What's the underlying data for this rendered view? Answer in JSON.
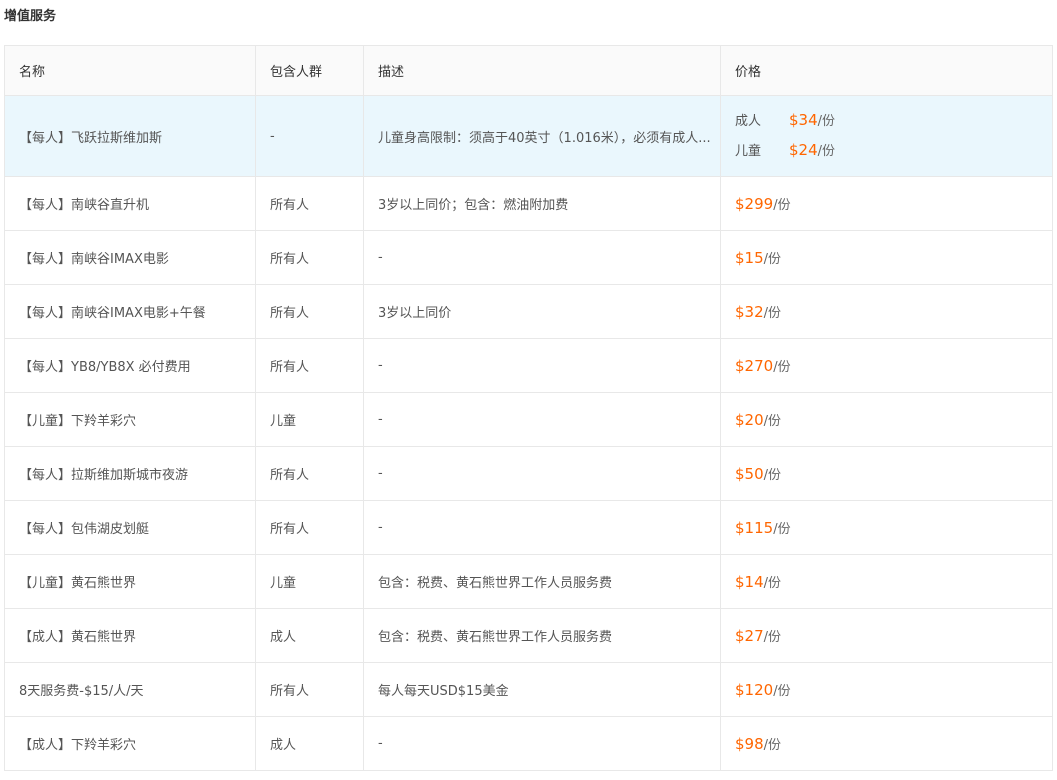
{
  "section_title": "增值服务",
  "columns": {
    "name": "名称",
    "audience": "包含人群",
    "description": "描述",
    "price": "价格"
  },
  "highlight_row": {
    "name": "【每人】飞跃拉斯维加斯",
    "audience": "-",
    "description": "儿童身高限制：须高于40英寸（1.016米），必须有成人...",
    "prices": [
      {
        "label": "成人",
        "amount": "$34",
        "unit": "/份"
      },
      {
        "label": "儿童",
        "amount": "$24",
        "unit": "/份"
      }
    ]
  },
  "rows": [
    {
      "name": "【每人】南峡谷直升机",
      "audience": "所有人",
      "description": "3岁以上同价；包含：燃油附加费",
      "amount": "$299",
      "unit": "/份"
    },
    {
      "name": "【每人】南峡谷IMAX电影",
      "audience": "所有人",
      "description": "-",
      "amount": "$15",
      "unit": "/份"
    },
    {
      "name": "【每人】南峡谷IMAX电影+午餐",
      "audience": "所有人",
      "description": "3岁以上同价",
      "amount": "$32",
      "unit": "/份"
    },
    {
      "name": "【每人】YB8/YB8X 必付费用",
      "audience": "所有人",
      "description": "-",
      "amount": "$270",
      "unit": "/份"
    },
    {
      "name": "【儿童】下羚羊彩穴",
      "audience": "儿童",
      "description": "-",
      "amount": "$20",
      "unit": "/份"
    },
    {
      "name": "【每人】拉斯维加斯城市夜游",
      "audience": "所有人",
      "description": "-",
      "amount": "$50",
      "unit": "/份"
    },
    {
      "name": "【每人】包伟湖皮划艇",
      "audience": "所有人",
      "description": "-",
      "amount": "$115",
      "unit": "/份"
    },
    {
      "name": "【儿童】黄石熊世界",
      "audience": "儿童",
      "description": "包含：税费、黄石熊世界工作人员服务费",
      "amount": "$14",
      "unit": "/份"
    },
    {
      "name": "【成人】黄石熊世界",
      "audience": "成人",
      "description": "包含：税费、黄石熊世界工作人员服务费",
      "amount": "$27",
      "unit": "/份"
    },
    {
      "name": "8天服务费-$15/人/天",
      "audience": "所有人",
      "description": "每人每天USD$15美金",
      "amount": "$120",
      "unit": "/份"
    },
    {
      "name": "【成人】下羚羊彩穴",
      "audience": "成人",
      "description": "-",
      "amount": "$98",
      "unit": "/份"
    }
  ],
  "colors": {
    "price": "#ff6600",
    "highlight_bg": "#eaf7fd",
    "header_bg": "#fafafa",
    "border": "#e8e8e8"
  }
}
